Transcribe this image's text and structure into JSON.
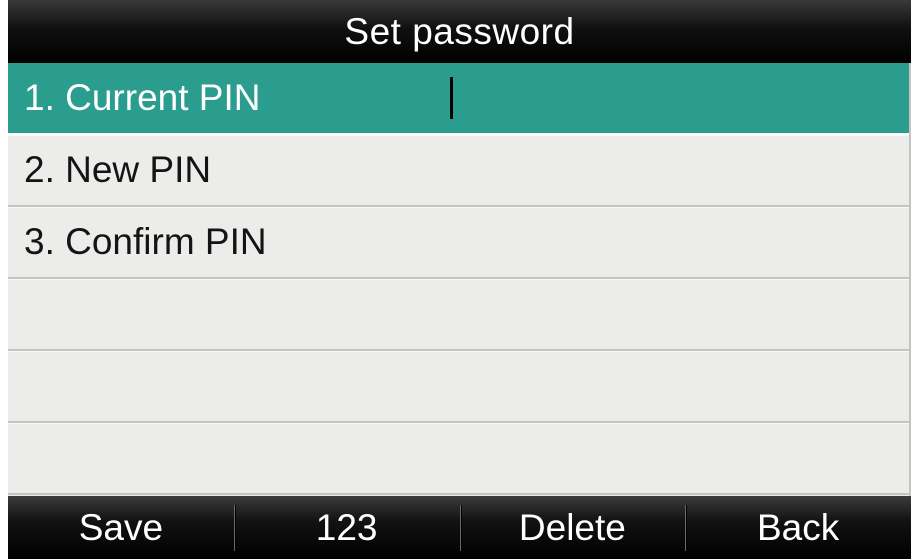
{
  "title": "Set password",
  "rows": [
    {
      "label": "1. Current PIN",
      "value": "",
      "selected": true
    },
    {
      "label": "2. New PIN",
      "value": "",
      "selected": false
    },
    {
      "label": "3. Confirm PIN",
      "value": "",
      "selected": false
    },
    {
      "label": "",
      "value": "",
      "selected": false
    },
    {
      "label": "",
      "value": "",
      "selected": false
    },
    {
      "label": "",
      "value": "",
      "selected": false
    }
  ],
  "softkeys": {
    "save": "Save",
    "input_mode": "123",
    "delete": "Delete",
    "back": "Back"
  },
  "colors": {
    "highlight": "#2a9d8e",
    "row_background": "#ececea",
    "bar_background": "#000000"
  }
}
